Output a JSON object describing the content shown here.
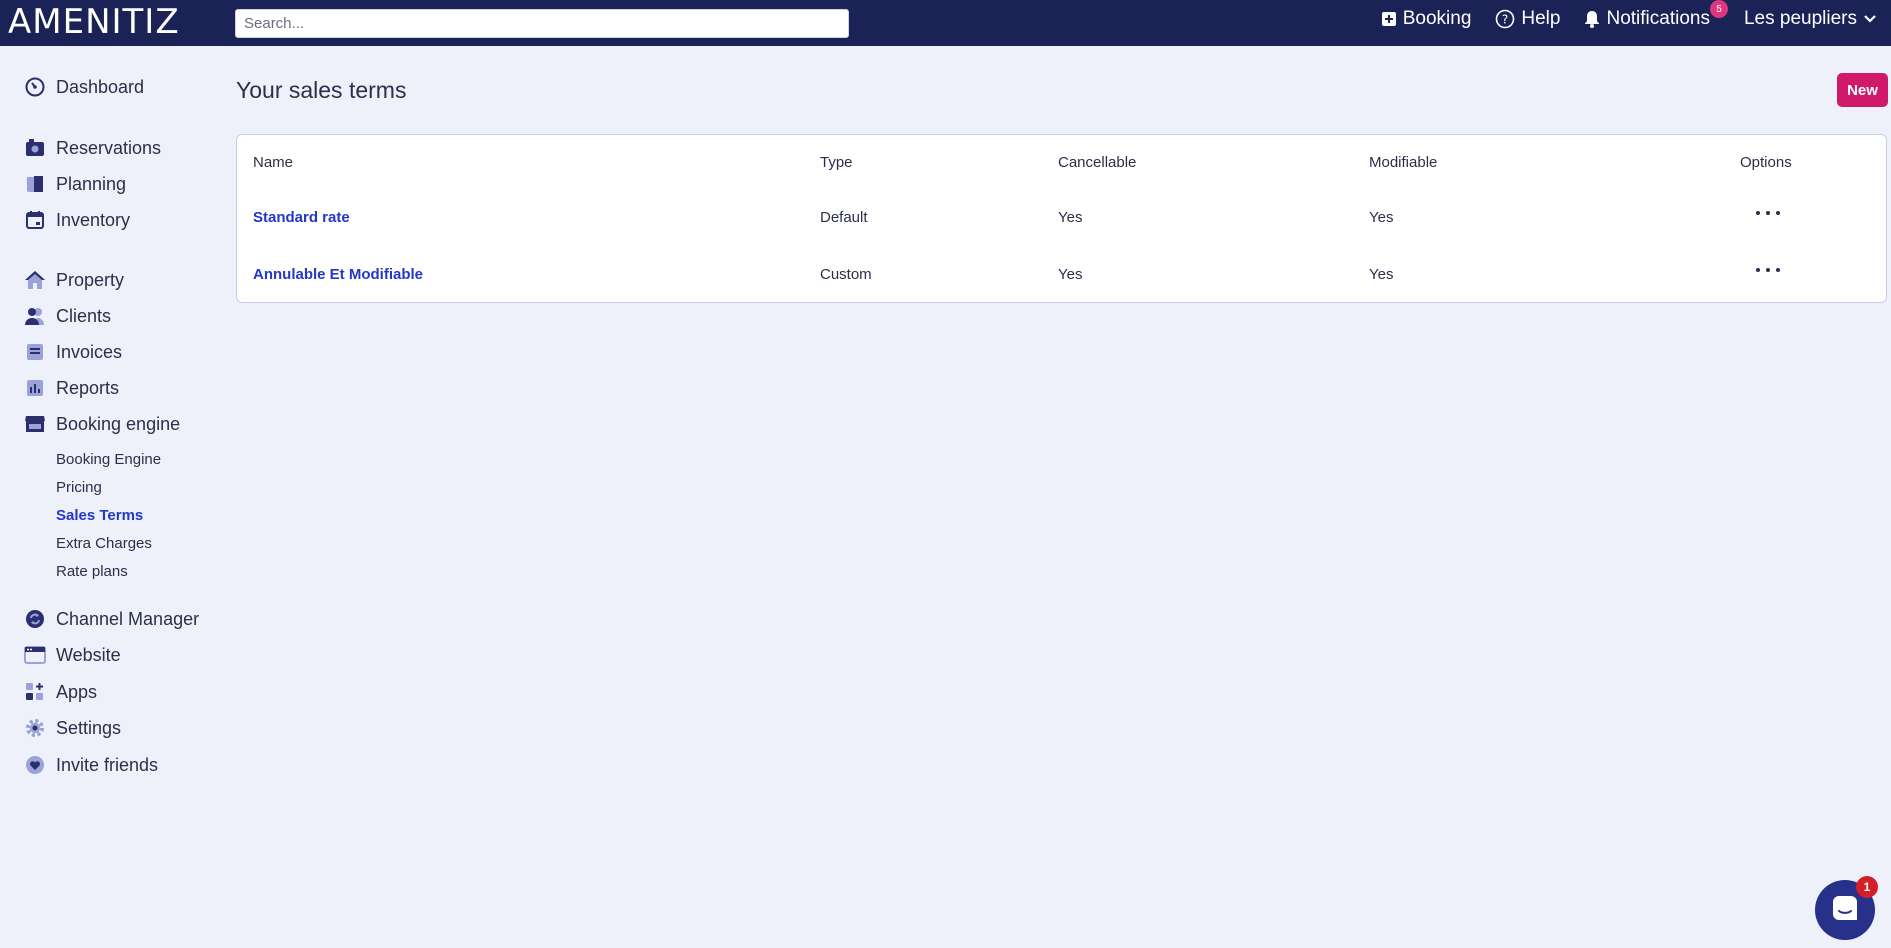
{
  "header": {
    "logo": "AMENITIZ",
    "search_placeholder": "Search...",
    "booking_label": "Booking",
    "help_label": "Help",
    "notifications_label": "Notifications",
    "notifications_count": "5",
    "account_label": "Les peupliers"
  },
  "sidebar": {
    "items": [
      {
        "label": "Dashboard",
        "icon": "dashboard-icon"
      },
      {
        "label": "Reservations",
        "icon": "reservations-icon"
      },
      {
        "label": "Planning",
        "icon": "planning-icon"
      },
      {
        "label": "Inventory",
        "icon": "calendar-icon"
      },
      {
        "label": "Property",
        "icon": "home-icon"
      },
      {
        "label": "Clients",
        "icon": "users-icon"
      },
      {
        "label": "Invoices",
        "icon": "invoice-icon"
      },
      {
        "label": "Reports",
        "icon": "chart-icon"
      },
      {
        "label": "Booking engine",
        "icon": "store-icon"
      },
      {
        "label": "Channel Manager",
        "icon": "sync-icon"
      },
      {
        "label": "Website",
        "icon": "browser-icon"
      },
      {
        "label": "Apps",
        "icon": "apps-icon"
      },
      {
        "label": "Settings",
        "icon": "gear-icon"
      },
      {
        "label": "Invite friends",
        "icon": "heart-icon"
      }
    ],
    "booking_engine_sub": [
      {
        "label": "Booking Engine"
      },
      {
        "label": "Pricing"
      },
      {
        "label": "Sales Terms",
        "active": true
      },
      {
        "label": "Extra Charges"
      },
      {
        "label": "Rate plans"
      }
    ]
  },
  "main": {
    "title": "Your sales terms",
    "new_button": "New",
    "table": {
      "columns": [
        "Name",
        "Type",
        "Cancellable",
        "Modifiable",
        "Options"
      ],
      "rows": [
        {
          "name": "Standard rate",
          "type": "Default",
          "cancellable": "Yes",
          "modifiable": "Yes"
        },
        {
          "name": "Annulable Et Modifiable",
          "type": "Custom",
          "cancellable": "Yes",
          "modifiable": "Yes"
        }
      ]
    }
  },
  "chat": {
    "badge": "1"
  },
  "colors": {
    "topbar": "#1b2356",
    "background": "#eef0fa",
    "accent": "#d0196b",
    "link": "#2338c8"
  }
}
